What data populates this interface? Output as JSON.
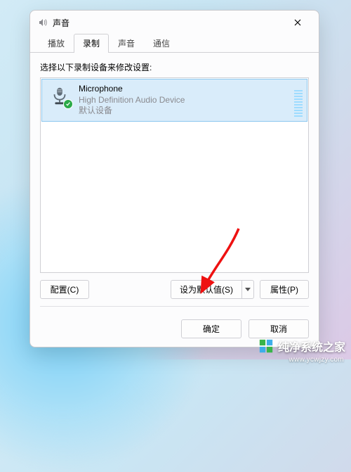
{
  "window": {
    "title": "声音"
  },
  "tabs": [
    {
      "label": "播放",
      "active": false
    },
    {
      "label": "录制",
      "active": true
    },
    {
      "label": "声音",
      "active": false
    },
    {
      "label": "通信",
      "active": false
    }
  ],
  "prompt": "选择以下录制设备来修改设置:",
  "devices": [
    {
      "name": "Microphone",
      "subtitle": "High Definition Audio Device",
      "status": "默认设备",
      "icon": "microphone-icon",
      "default": true
    }
  ],
  "buttons": {
    "configure": "配置(C)",
    "set_default": "设为默认值(S)",
    "properties": "属性(P)",
    "ok": "确定",
    "cancel": "取消"
  },
  "watermark": {
    "text": "纯净系统之家",
    "url": "www.ycwjzy.com"
  }
}
